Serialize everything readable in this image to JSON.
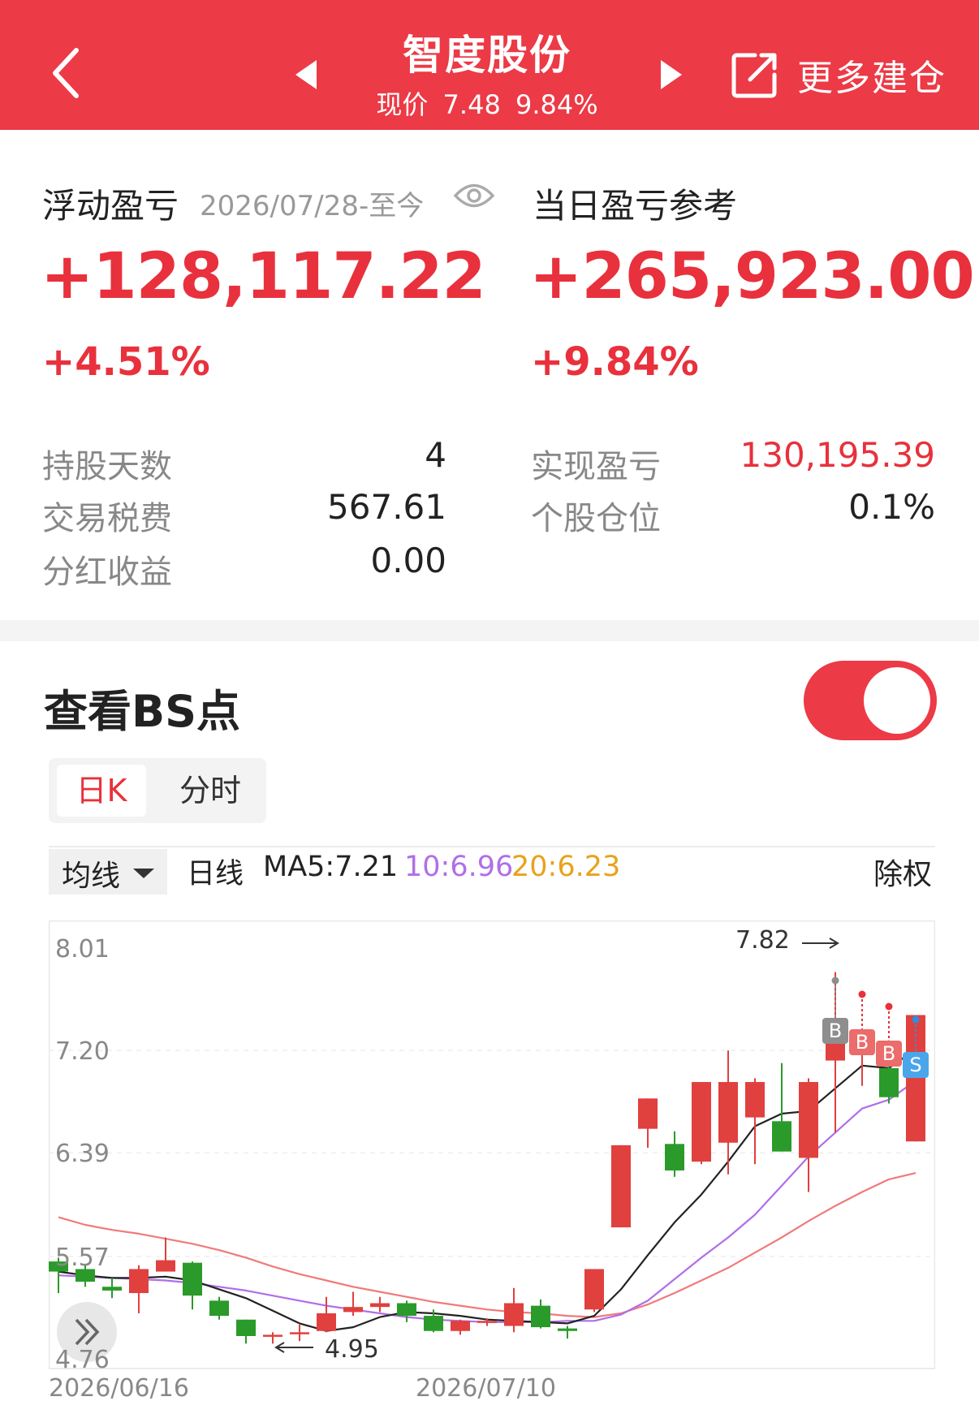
{
  "header": {
    "title": "智度股份",
    "price_label": "现价",
    "price": "7.48",
    "change": "9.84%",
    "more_label": "更多建仓"
  },
  "summary": {
    "floating_label": "浮动盈亏",
    "floating_date": "2026/07/28-至今",
    "floating_value": "+128,117.22",
    "floating_pct": "+4.51%",
    "daily_label": "当日盈亏参考",
    "daily_value": "+265,923.00",
    "daily_pct": "+9.84%"
  },
  "stats": {
    "left": [
      {
        "label": "持股天数",
        "value": "4"
      },
      {
        "label": "交易税费",
        "value": "567.61"
      },
      {
        "label": "分红收益",
        "value": "0.00"
      }
    ],
    "right": [
      {
        "label": "实现盈亏",
        "value": "130,195.39"
      },
      {
        "label": "个股仓位",
        "value": "0.1%"
      }
    ]
  },
  "bs": {
    "title": "查看BS点",
    "toggle_on": true,
    "tabs": [
      "日K",
      "分时"
    ]
  },
  "ma_bar": {
    "select_label": "均线",
    "line_label": "日线",
    "ma5": "MA5:7.21",
    "ma10": "10:6.96",
    "ma20": "20:6.23",
    "adjust_label": "除权"
  },
  "colors": {
    "brand_red": "#ec3a46",
    "up": "#e0403e",
    "down": "#2a9a2a",
    "ma5": "#222222",
    "ma10": "#b06ee8",
    "ma20": "#f07a7a",
    "ma20_text": "#e8a21c"
  },
  "chart_data": {
    "type": "candlestick",
    "y_ticks": [
      "8.01",
      "7.20",
      "6.39",
      "5.57",
      "4.76"
    ],
    "x_labels": [
      "2026/06/16",
      "2026/07/10"
    ],
    "max_annotation": "7.82",
    "min_annotation": "4.95",
    "candles": [
      {
        "o": 5.53,
        "c": 5.45,
        "h": 5.56,
        "l": 5.28
      },
      {
        "o": 5.47,
        "c": 5.37,
        "h": 5.5,
        "l": 5.33
      },
      {
        "o": 5.33,
        "c": 5.3,
        "h": 5.4,
        "l": 5.24
      },
      {
        "o": 5.28,
        "c": 5.47,
        "h": 5.5,
        "l": 5.12
      },
      {
        "o": 5.45,
        "c": 5.54,
        "h": 5.72,
        "l": 5.45
      },
      {
        "o": 5.52,
        "c": 5.26,
        "h": 5.53,
        "l": 5.15
      },
      {
        "o": 5.22,
        "c": 5.1,
        "h": 5.25,
        "l": 5.07
      },
      {
        "o": 5.07,
        "c": 4.94,
        "h": 5.07,
        "l": 4.88
      },
      {
        "o": 4.95,
        "c": 4.95,
        "h": 4.97,
        "l": 4.88
      },
      {
        "o": 4.97,
        "c": 4.97,
        "h": 5.03,
        "l": 4.9
      },
      {
        "o": 4.98,
        "c": 5.12,
        "h": 5.25,
        "l": 4.97
      },
      {
        "o": 5.13,
        "c": 5.17,
        "h": 5.29,
        "l": 5.1
      },
      {
        "o": 5.17,
        "c": 5.2,
        "h": 5.25,
        "l": 5.13
      },
      {
        "o": 5.2,
        "c": 5.1,
        "h": 5.22,
        "l": 5.05
      },
      {
        "o": 5.1,
        "c": 4.98,
        "h": 5.15,
        "l": 4.97
      },
      {
        "o": 4.98,
        "c": 5.06,
        "h": 5.07,
        "l": 4.95
      },
      {
        "o": 5.06,
        "c": 5.06,
        "h": 5.08,
        "l": 5.02
      },
      {
        "o": 5.02,
        "c": 5.2,
        "h": 5.32,
        "l": 4.97
      },
      {
        "o": 5.18,
        "c": 5.01,
        "h": 5.23,
        "l": 5.0
      },
      {
        "o": 5.0,
        "c": 4.98,
        "h": 5.02,
        "l": 4.92
      },
      {
        "o": 5.15,
        "c": 5.47,
        "h": 5.47,
        "l": 5.13
      },
      {
        "o": 5.8,
        "c": 6.45,
        "h": 6.45,
        "l": 5.8
      },
      {
        "o": 6.58,
        "c": 6.82,
        "h": 6.82,
        "l": 6.43
      },
      {
        "o": 6.46,
        "c": 6.25,
        "h": 6.56,
        "l": 6.2
      },
      {
        "o": 6.32,
        "c": 6.95,
        "h": 6.95,
        "l": 6.3
      },
      {
        "o": 6.47,
        "c": 6.95,
        "h": 7.2,
        "l": 6.22
      },
      {
        "o": 6.67,
        "c": 6.95,
        "h": 6.98,
        "l": 6.3
      },
      {
        "o": 6.64,
        "c": 6.4,
        "h": 7.1,
        "l": 6.4
      },
      {
        "o": 6.35,
        "c": 6.95,
        "h": 6.98,
        "l": 6.08
      },
      {
        "o": 7.12,
        "c": 7.4,
        "h": 7.82,
        "l": 6.55
      },
      {
        "o": 7.18,
        "c": 7.18,
        "h": 7.35,
        "l": 6.92
      },
      {
        "o": 7.06,
        "c": 6.83,
        "h": 7.28,
        "l": 6.78
      },
      {
        "o": 6.48,
        "c": 7.48,
        "h": 7.48,
        "l": 6.48
      }
    ],
    "ma5": [
      5.45,
      5.42,
      5.4,
      5.4,
      5.41,
      5.38,
      5.31,
      5.24,
      5.14,
      5.04,
      4.98,
      5.01,
      5.09,
      5.13,
      5.12,
      5.1,
      5.07,
      5.06,
      5.05,
      5.04,
      5.1,
      5.31,
      5.58,
      5.84,
      6.06,
      6.32,
      6.6,
      6.7,
      6.72,
      6.9,
      7.08,
      7.06,
      7.21
    ],
    "ma10": [
      5.42,
      5.41,
      5.4,
      5.39,
      5.38,
      5.36,
      5.33,
      5.3,
      5.26,
      5.22,
      5.18,
      5.15,
      5.12,
      5.09,
      5.07,
      5.06,
      5.05,
      5.05,
      5.05,
      5.06,
      5.06,
      5.11,
      5.22,
      5.39,
      5.56,
      5.72,
      5.9,
      6.13,
      6.36,
      6.55,
      6.74,
      6.81,
      6.96
    ],
    "ma20": [
      5.88,
      5.82,
      5.78,
      5.75,
      5.71,
      5.67,
      5.62,
      5.56,
      5.49,
      5.43,
      5.38,
      5.33,
      5.29,
      5.25,
      5.21,
      5.18,
      5.15,
      5.13,
      5.12,
      5.1,
      5.09,
      5.12,
      5.19,
      5.28,
      5.38,
      5.48,
      5.6,
      5.72,
      5.85,
      5.97,
      6.08,
      6.18,
      6.23
    ],
    "bs_markers": [
      {
        "index": 29,
        "type": "B",
        "style": "gray"
      },
      {
        "index": 30,
        "type": "B",
        "style": "red"
      },
      {
        "index": 31,
        "type": "B",
        "style": "red"
      },
      {
        "index": 32,
        "type": "S",
        "style": "blue"
      }
    ]
  }
}
